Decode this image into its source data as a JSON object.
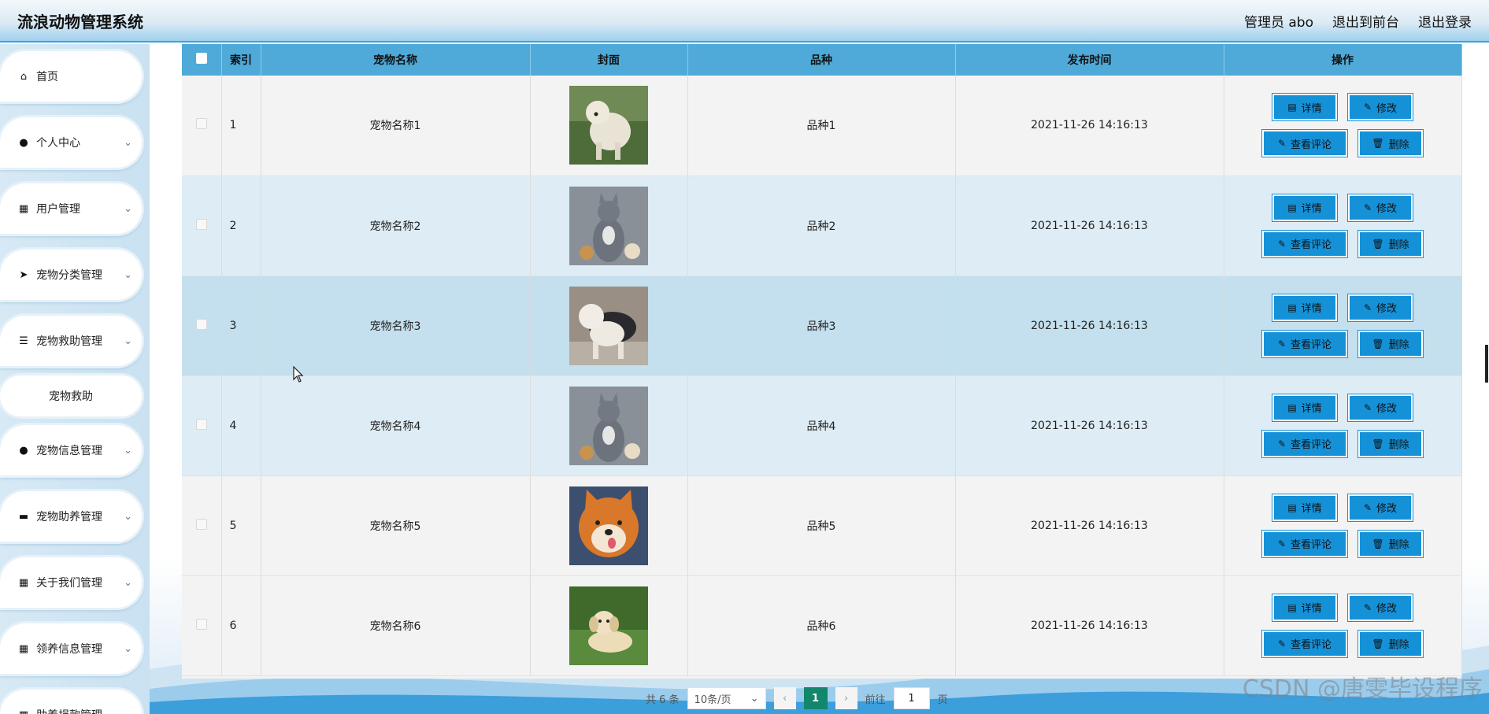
{
  "header": {
    "title": "流浪动物管理系统",
    "admin_label": "管理员 abo",
    "front_label": "退出到前台",
    "logout_label": "退出登录"
  },
  "sidebar": {
    "items": [
      {
        "label": "首页",
        "icon": "home-icon"
      },
      {
        "label": "个人中心",
        "icon": "user-icon"
      },
      {
        "label": "用户管理",
        "icon": "grid-icon"
      },
      {
        "label": "宠物分类管理",
        "icon": "send-icon"
      },
      {
        "label": "宠物救助管理",
        "icon": "sliders-icon"
      },
      {
        "label": "宠物救助",
        "icon": ""
      },
      {
        "label": "宠物信息管理",
        "icon": "user-icon"
      },
      {
        "label": "宠物助养管理",
        "icon": "briefcase-icon"
      },
      {
        "label": "关于我们管理",
        "icon": "grid-icon"
      },
      {
        "label": "领养信息管理",
        "icon": "grid-icon"
      },
      {
        "label": "助养捐款管理",
        "icon": "grid-icon"
      }
    ]
  },
  "table": {
    "columns": [
      "索引",
      "宠物名称",
      "封面",
      "品种",
      "发布时间",
      "操作"
    ],
    "rows": [
      {
        "index": "1",
        "name": "宠物名称1",
        "breed": "品种1",
        "time": "2021-11-26 14:16:13",
        "cover": "sheepdog-photo"
      },
      {
        "index": "2",
        "name": "宠物名称2",
        "breed": "品种2",
        "time": "2021-11-26 14:16:13",
        "cover": "gray-cat-photo"
      },
      {
        "index": "3",
        "name": "宠物名称3",
        "breed": "品种3",
        "time": "2021-11-26 14:16:13",
        "cover": "sheepdog-photo"
      },
      {
        "index": "4",
        "name": "宠物名称4",
        "breed": "品种4",
        "time": "2021-11-26 14:16:13",
        "cover": "gray-cat-photo"
      },
      {
        "index": "5",
        "name": "宠物名称5",
        "breed": "品种5",
        "time": "2021-11-26 14:16:13",
        "cover": "shiba-photo"
      },
      {
        "index": "6",
        "name": "宠物名称6",
        "breed": "品种6",
        "time": "2021-11-26 14:16:13",
        "cover": "puppy-photo"
      }
    ],
    "actions": {
      "detail": "详情",
      "edit": "修改",
      "comments": "查看评论",
      "delete": "删除"
    }
  },
  "pagination": {
    "total_label": "共 6 条",
    "page_size": "10条/页",
    "current_page": "1",
    "goto_label": "前往",
    "goto_value": "1",
    "page_suffix": "页"
  },
  "watermark": "CSDN @唐雯毕设程序",
  "colors": {
    "accent": "#1591d8",
    "header_row": "#4faad9",
    "active_page": "#13876b"
  }
}
